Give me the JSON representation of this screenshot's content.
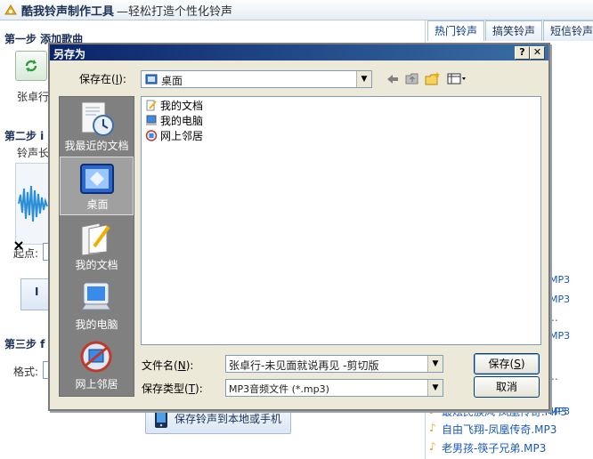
{
  "app": {
    "title_main": "酷我铃声制作工具",
    "title_sub": "—轻松打造个性化铃声"
  },
  "left": {
    "step1_title": "第一步 添加歌曲",
    "step1_file_prefix": "张卓行",
    "step2_title": "第二步 i",
    "ringtone_length_prefix": "铃声长",
    "start_point_label": "起点:",
    "play_prefix": "I",
    "step3_title": "第三步 f",
    "format_label": "格式:",
    "save_button_label": "保存铃声到本地或手机"
  },
  "right": {
    "tabs": [
      "热门铃声",
      "搞笑铃声",
      "短信铃声"
    ],
    "mp3_tags": [
      "3",
      "3",
      "3",
      "3",
      "3",
      "3",
      "3",
      "3",
      "3",
      "MP3",
      "MP3",
      "MP3",
      "MP3"
    ],
    "dots": [
      "..",
      ".."
    ],
    "songs": [
      "最炫民族风 凤凰传奇.MP3",
      "自由飞翔-凤凰传奇.MP3",
      "老男孩-筷子兄弟.MP3"
    ]
  },
  "dialog": {
    "title": "另存为",
    "help_button": "?",
    "close_button": "✕",
    "save_in_label": "保存在",
    "save_in_hotkey": "I",
    "save_in_value": "桌面",
    "places": [
      {
        "label": "我最近的文档",
        "icon": "recent-documents-icon"
      },
      {
        "label": "桌面",
        "icon": "desktop-icon"
      },
      {
        "label": "我的文档",
        "icon": "my-documents-icon"
      },
      {
        "label": "我的电脑",
        "icon": "my-computer-icon"
      },
      {
        "label": "网上邻居",
        "icon": "network-places-icon"
      }
    ],
    "files": [
      {
        "label": "我的文档",
        "icon": "my-documents-icon"
      },
      {
        "label": "我的电脑",
        "icon": "my-computer-icon"
      },
      {
        "label": "网上邻居",
        "icon": "network-places-icon"
      }
    ],
    "filename_label": "文件名",
    "filename_hotkey": "N",
    "filename_value": "张卓行-未见面就说再见 -剪切版",
    "filetype_label": "保存类型",
    "filetype_hotkey": "T",
    "filetype_value": "MP3音频文件 (*.mp3)",
    "save_label": "保存",
    "save_hotkey": "S",
    "cancel_label": "取消"
  },
  "colors": {
    "dialog_title_start": "#0a246a",
    "dialog_title_end": "#3a6ea5",
    "accent_link": "#1a58b6"
  }
}
